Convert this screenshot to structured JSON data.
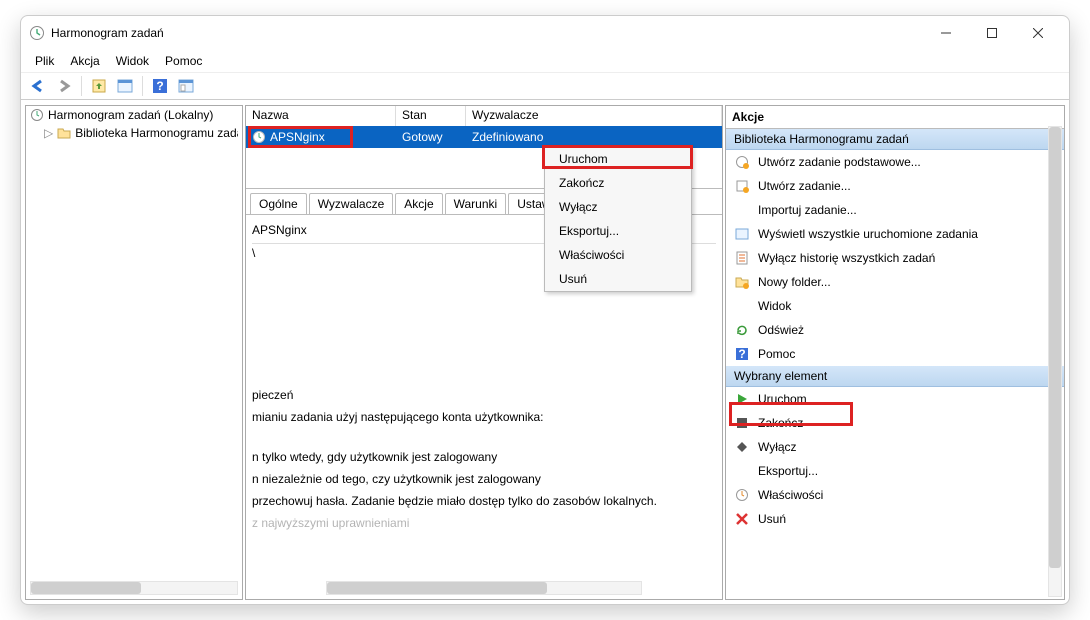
{
  "titlebar": {
    "title": "Harmonogram zadań"
  },
  "menu": {
    "file": "Plik",
    "action": "Akcja",
    "view": "Widok",
    "help": "Pomoc"
  },
  "tree": {
    "root": "Harmonogram zadań (Lokalny)",
    "lib": "Biblioteka Harmonogramu zadań"
  },
  "columns": {
    "name": "Nazwa",
    "state": "Stan",
    "triggers": "Wyzwalacze"
  },
  "task": {
    "name": "APSNginx",
    "state": "Gotowy",
    "triggers": "Zdefiniowano"
  },
  "tabs": {
    "general": "Ogólne",
    "triggers": "Wyzwalacze",
    "actions": "Akcje",
    "conditions": "Warunki",
    "settings": "Ustawienia"
  },
  "details": {
    "name": "APSNginx",
    "slash": "\\",
    "l1": "pieczeń",
    "l2": "mianiu zadania użyj następującego konta użytkownika:",
    "l3": "n tylko wtedy, gdy użytkownik jest zalogowany",
    "l4": "n niezależnie od tego, czy użytkownik jest zalogowany",
    "l5": "przechowuj hasła. Zadanie będzie miało dostęp tylko do zasobów lokalnych.",
    "l6": "z najwyższymi uprawnieniami"
  },
  "ctx": {
    "run": "Uruchom",
    "end": "Zakończ",
    "disable": "Wyłącz",
    "export": "Eksportuj...",
    "props": "Właściwości",
    "delete": "Usuń"
  },
  "actionsPanel": {
    "title": "Akcje",
    "section1": "Biblioteka Harmonogramu zadań",
    "createBasic": "Utwórz zadanie podstawowe...",
    "create": "Utwórz zadanie...",
    "import": "Importuj zadanie...",
    "showRunning": "Wyświetl wszystkie uruchomione zadania",
    "disableHist": "Wyłącz historię wszystkich zadań",
    "newFolder": "Nowy folder...",
    "view": "Widok",
    "refresh": "Odśwież",
    "help": "Pomoc",
    "section2": "Wybrany element",
    "run": "Uruchom",
    "end": "Zakończ",
    "disable": "Wyłącz",
    "export": "Eksportuj...",
    "props": "Właściwości",
    "delete": "Usuń"
  }
}
